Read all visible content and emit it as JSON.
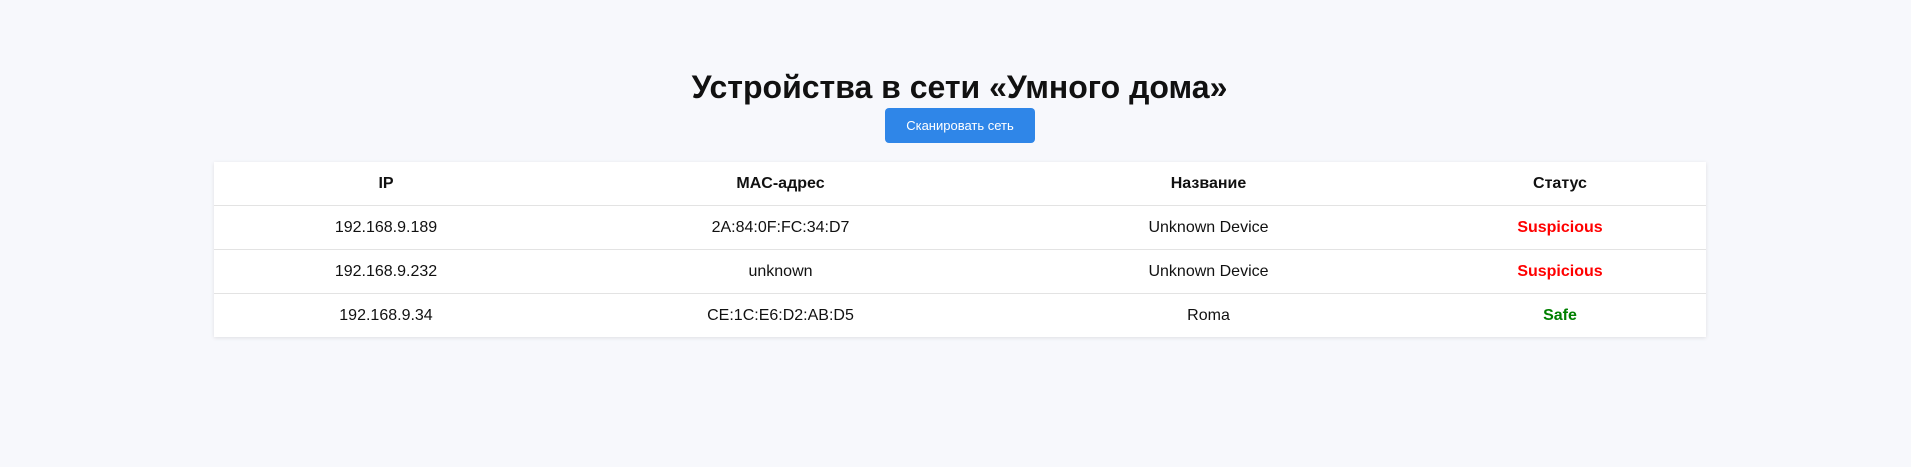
{
  "page": {
    "title": "Устройства в сети «Умного дома»",
    "scan_button_label": "Сканировать сеть"
  },
  "table": {
    "headers": {
      "ip": "IP",
      "mac": "MAC-адрес",
      "name": "Название",
      "status": "Статус"
    },
    "rows": [
      {
        "ip": "192.168.9.189",
        "mac": "2A:84:0F:FC:34:D7",
        "name": "Unknown Device",
        "status": "Suspicious"
      },
      {
        "ip": "192.168.9.232",
        "mac": "unknown",
        "name": "Unknown Device",
        "status": "Suspicious"
      },
      {
        "ip": "192.168.9.34",
        "mac": "CE:1C:E6:D2:AB:D5",
        "name": "Roma",
        "status": "Safe"
      }
    ]
  },
  "colors": {
    "background": "#f7f8fc",
    "button": "#2f86e8",
    "status_suspicious": "#ff0000",
    "status_safe": "#008000"
  }
}
